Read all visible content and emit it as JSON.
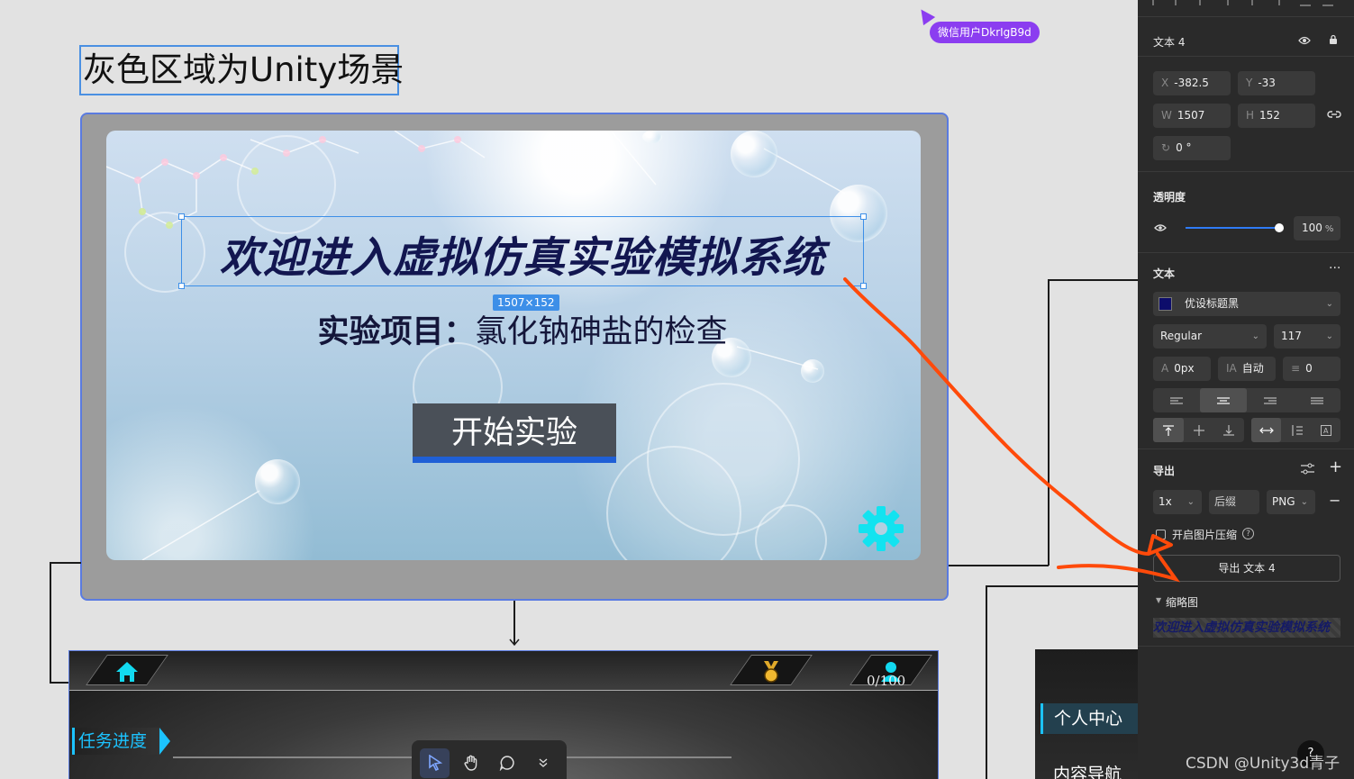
{
  "canvas": {
    "page_title": "灰色区域为Unity场景",
    "collaborator_tag": "微信用户DkrIgB9d",
    "scene": {
      "title": "欢迎进入虚拟仿真实验模拟系统",
      "selection_size": "1507×152",
      "subtitle_bold": "实验项目：",
      "subtitle_rest": "氯化钠砷盐的检查",
      "start_button": "开始实验"
    },
    "game_ui": {
      "score": "0/100",
      "task_progress": "任务进度"
    },
    "side_menu": {
      "item_active": "个人中心",
      "item_2": "内容导航"
    },
    "accent_color": "#1cc3ff"
  },
  "panel": {
    "layer_name": "文本 4",
    "x_label": "X",
    "x_value": "-382.5",
    "y_label": "Y",
    "y_value": "-33",
    "w_label": "W",
    "w_value": "1507",
    "h_label": "H",
    "h_value": "152",
    "rotation": "0 °",
    "opacity_title": "透明度",
    "opacity_value": "100",
    "opacity_unit": "%",
    "text_section": "文本",
    "font_name": "优设标题黑",
    "font_color": "#0d0d6b",
    "font_weight": "Regular",
    "font_size": "117",
    "letter_spacing": "0px",
    "line_height": "自动",
    "paragraph_spacing": "0",
    "export_title": "导出",
    "export_scale": "1x",
    "export_suffix": "后缀",
    "export_format": "PNG",
    "compress_label": "开启图片压缩",
    "export_button": "导出 文本 4",
    "thumbnail_title": "缩略图",
    "thumbnail_text": "欢迎进入虚拟仿真实验模拟系统"
  },
  "help_label": "?",
  "watermark": "CSDN @Unity3d青子"
}
